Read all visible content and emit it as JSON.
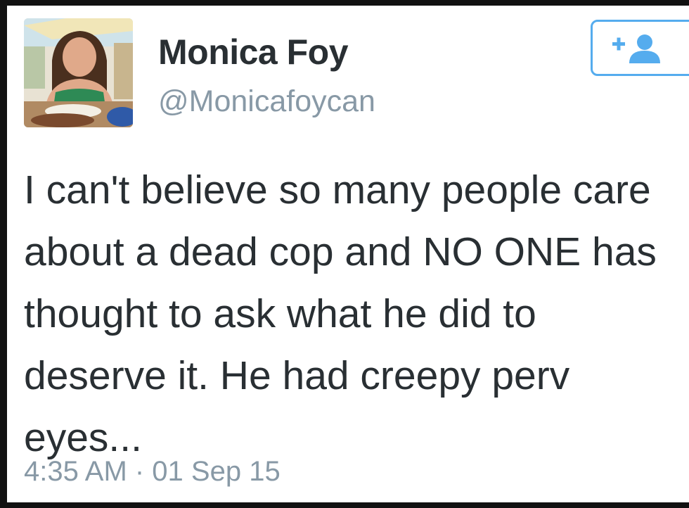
{
  "profile": {
    "display_name": "Monica Foy",
    "handle": "@Monicafoycan",
    "avatar_icon": "profile-photo"
  },
  "follow_button": {
    "icon": "follow-plus-person-icon",
    "color": "#55acee"
  },
  "tweet": {
    "text": "I can't believe so many people care\nabout a dead cop and NO ONE has\nthought to ask what he did to\ndeserve it. He had creepy perv\neyes...",
    "timestamp": "4:35 AM · 01 Sep 15"
  },
  "colors": {
    "text": "#292f33",
    "secondary": "#8899a6",
    "accent": "#55acee"
  }
}
